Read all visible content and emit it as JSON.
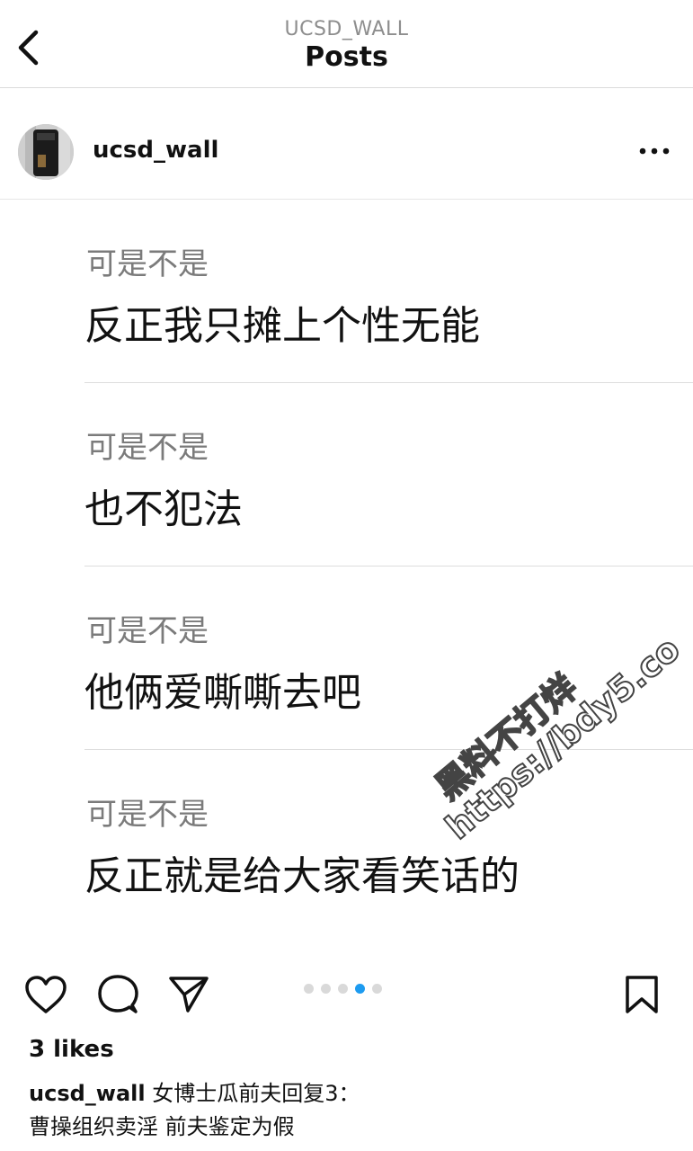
{
  "topbar": {
    "account": "UCSD_WALL",
    "title": "Posts"
  },
  "post": {
    "username": "ucsd_wall",
    "entries": [
      {
        "q": "可是不是",
        "a": "反正我只摊上个性无能"
      },
      {
        "q": "可是不是",
        "a": "也不犯法"
      },
      {
        "q": "可是不是",
        "a": "他俩爱嘶嘶去吧"
      },
      {
        "q": "可是不是",
        "a": "反正就是给大家看笑话的"
      }
    ],
    "watermark": {
      "line1": "黑料不打烊",
      "line2": "https://bdy5.co"
    },
    "carousel": {
      "count": 5,
      "active_index": 3
    },
    "likes": "3 likes",
    "caption_user": "ucsd_wall",
    "caption_line1": "女博士瓜前夫回复3：",
    "caption_line2": "曹操组织卖淫 前夫鉴定为假"
  },
  "icons": [
    "back-arrow-icon",
    "more-options-icon",
    "heart-icon",
    "comment-icon",
    "share-icon",
    "bookmark-icon"
  ],
  "colors": {
    "text": "#111111",
    "secondary": "#7b7b7b",
    "carousel_active": "#1d9bf0"
  }
}
